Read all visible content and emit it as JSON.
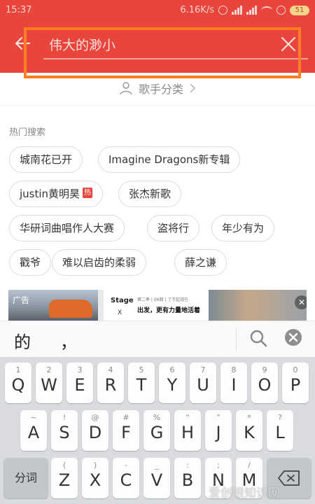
{
  "status_bar": {
    "time": "15:37",
    "network_speed": "6.16K/s",
    "battery": "51"
  },
  "search": {
    "query": "伟大的渺小"
  },
  "singer_category": {
    "label": "歌手分类"
  },
  "hot_search": {
    "title": "热门搜索",
    "hot_badge": "热",
    "items": [
      "城南花已开",
      "Imagine Dragons新专辑",
      "justin黄明昊",
      "张杰新歌",
      "华研词曲唱作人大赛",
      "盗将行",
      "年少有为",
      "戳爷",
      "难以启齿的柔弱",
      "薛之谦"
    ]
  },
  "ad": {
    "label": "广告",
    "brand": "Stage.",
    "brand_mark": "X",
    "subline": "第二季 | 06期 | 了不起现在",
    "headline": "出发，更有力量地活着"
  },
  "candidates": {
    "items": [
      "的",
      "，"
    ]
  },
  "keyboard": {
    "row1": [
      {
        "sub": "1",
        "main": "Q"
      },
      {
        "sub": "2",
        "main": "W"
      },
      {
        "sub": "3",
        "main": "E"
      },
      {
        "sub": "4",
        "main": "R"
      },
      {
        "sub": "5",
        "main": "T"
      },
      {
        "sub": "6",
        "main": "Y"
      },
      {
        "sub": "7",
        "main": "U"
      },
      {
        "sub": "8",
        "main": "I"
      },
      {
        "sub": "9",
        "main": "O"
      },
      {
        "sub": "0",
        "main": "P"
      }
    ],
    "row2": [
      {
        "sub": "~",
        "main": "A"
      },
      {
        "sub": "!",
        "main": "S"
      },
      {
        "sub": "@",
        "main": "D"
      },
      {
        "sub": "#",
        "main": "F"
      },
      {
        "sub": "%",
        "main": "G"
      },
      {
        "sub": "“",
        "main": "H"
      },
      {
        "sub": "”",
        "main": "J"
      },
      {
        "sub": "*",
        "main": "K"
      },
      {
        "sub": "?",
        "main": "L"
      }
    ],
    "row3": [
      {
        "sub": "(",
        "main": "Z"
      },
      {
        "sub": ")",
        "main": "X"
      },
      {
        "sub": "-",
        "main": "C"
      },
      {
        "sub": "_",
        "main": "V"
      },
      {
        "sub": ":",
        "main": "B"
      },
      {
        "sub": ";",
        "main": "N"
      },
      {
        "sub": "/",
        "main": "M"
      }
    ],
    "segment_key": "分词"
  },
  "watermark": "爱创根知识网",
  "colors": {
    "header_red": "#e8453d",
    "highlight_orange": "#ff7d22",
    "keyboard_bg": "#d9dbde"
  }
}
